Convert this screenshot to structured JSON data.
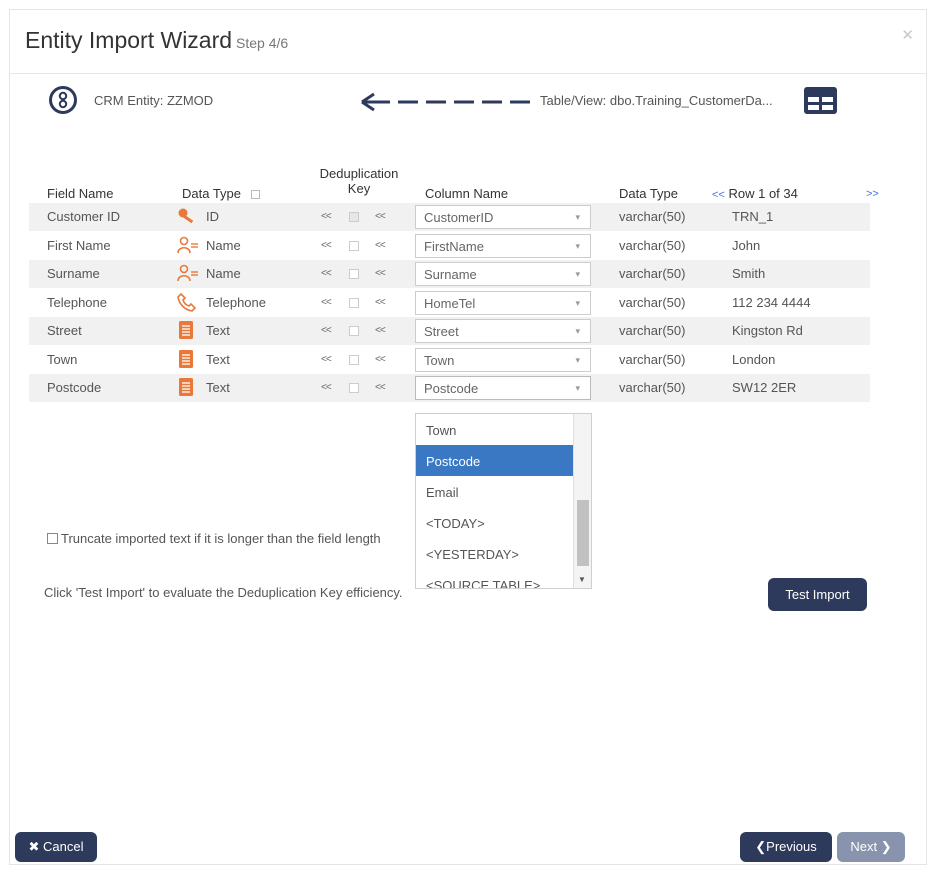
{
  "header": {
    "title": "Entity Import Wizard",
    "step": "Step 4/6",
    "close_icon": "close-icon"
  },
  "entity": {
    "label": "CRM Entity: ZZMOD",
    "icon": "entity-icon"
  },
  "table": {
    "label": "Table/View: dbo.Training_CustomerDa...",
    "icon": "table-grid-icon"
  },
  "columns": {
    "field_name": "Field Name",
    "data_type": "Data Type",
    "dedup_key_line1": "Deduplication",
    "dedup_key_line2": "Key",
    "column_name": "Column Name",
    "source_data_type": "Data Type",
    "row_prev": "<<",
    "row_label": "Row 1 of 34",
    "row_next": ">>"
  },
  "rows": [
    {
      "field": "Customer ID",
      "type": "ID",
      "type_icon": "key-icon",
      "column": "CustomerID",
      "src_type": "varchar(50)",
      "value": "TRN_1",
      "dedup": true
    },
    {
      "field": "First Name",
      "type": "Name",
      "type_icon": "person-name-icon",
      "column": "FirstName",
      "src_type": "varchar(50)",
      "value": "John",
      "dedup": false
    },
    {
      "field": "Surname",
      "type": "Name",
      "type_icon": "person-name-icon",
      "column": "Surname",
      "src_type": "varchar(50)",
      "value": "Smith",
      "dedup": false
    },
    {
      "field": "Telephone",
      "type": "Telephone",
      "type_icon": "phone-icon",
      "column": "HomeTel",
      "src_type": "varchar(50)",
      "value": "112 234 4444",
      "dedup": false
    },
    {
      "field": "Street",
      "type": "Text",
      "type_icon": "text-icon",
      "column": "Street",
      "src_type": "varchar(50)",
      "value": "Kingston Rd",
      "dedup": false
    },
    {
      "field": "Town",
      "type": "Text",
      "type_icon": "text-icon",
      "column": "Town",
      "src_type": "varchar(50)",
      "value": "London",
      "dedup": false
    },
    {
      "field": "Postcode",
      "type": "Text",
      "type_icon": "text-icon",
      "column": "Postcode",
      "src_type": "varchar(50)",
      "value": "SW12 2ER",
      "dedup": false
    }
  ],
  "chevrons": "<<",
  "dropdown": {
    "options": [
      "Town",
      "Postcode",
      "Email",
      "<TODAY>",
      "<YESTERDAY>",
      "<SOURCE TABLE>"
    ],
    "selected": "Postcode"
  },
  "truncate_label": "Truncate imported text if it is longer than the field length",
  "hint": "Click 'Test Import' to evaluate the Deduplication Key efficiency.",
  "buttons": {
    "test_import": "Test Import",
    "cancel": "Cancel",
    "previous": "Previous",
    "next": "Next"
  },
  "colors": {
    "primary": "#2d3a5c",
    "accent_orange": "#e8793a",
    "selected": "#3a78c3",
    "link": "#4a72d8"
  }
}
